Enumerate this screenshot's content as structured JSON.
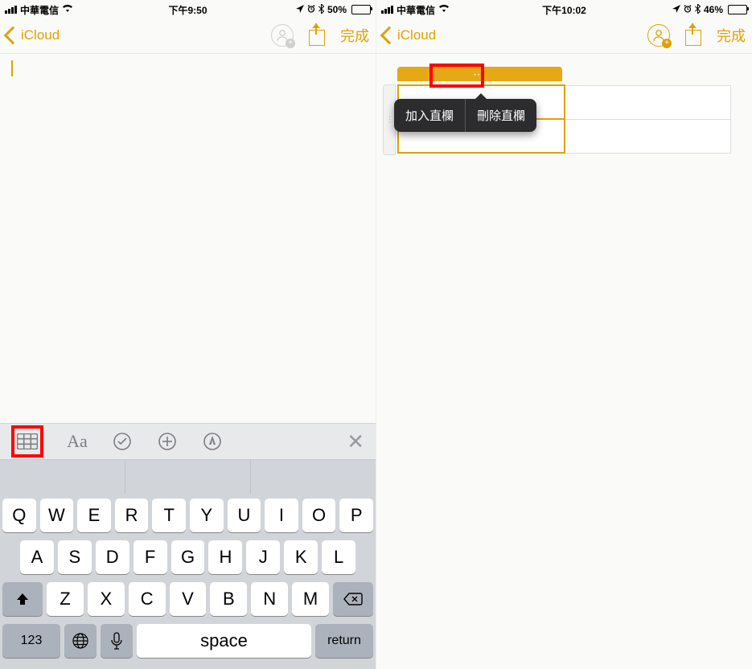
{
  "left": {
    "status": {
      "carrier": "中華電信",
      "time": "下午9:50",
      "battery_pct": "50%",
      "battery_fill": 50
    },
    "nav": {
      "back": "iCloud",
      "done": "完成"
    },
    "keyboard": {
      "toolbar_icons": [
        "table",
        "Aa",
        "checklist",
        "plus",
        "markup"
      ],
      "rows": [
        [
          "Q",
          "W",
          "E",
          "R",
          "T",
          "Y",
          "U",
          "I",
          "O",
          "P"
        ],
        [
          "A",
          "S",
          "D",
          "F",
          "G",
          "H",
          "J",
          "K",
          "L"
        ],
        [
          "Z",
          "X",
          "C",
          "V",
          "B",
          "N",
          "M"
        ]
      ],
      "num_key": "123",
      "space_key": "space",
      "return_key": "return"
    }
  },
  "right": {
    "status": {
      "carrier": "中華電信",
      "time": "下午10:02",
      "battery_pct": "46%",
      "battery_fill": 46
    },
    "nav": {
      "back": "iCloud",
      "done": "完成"
    },
    "popup": {
      "add_col": "加入直欄",
      "del_col": "刪除直欄"
    },
    "column_handle": "⋯"
  }
}
